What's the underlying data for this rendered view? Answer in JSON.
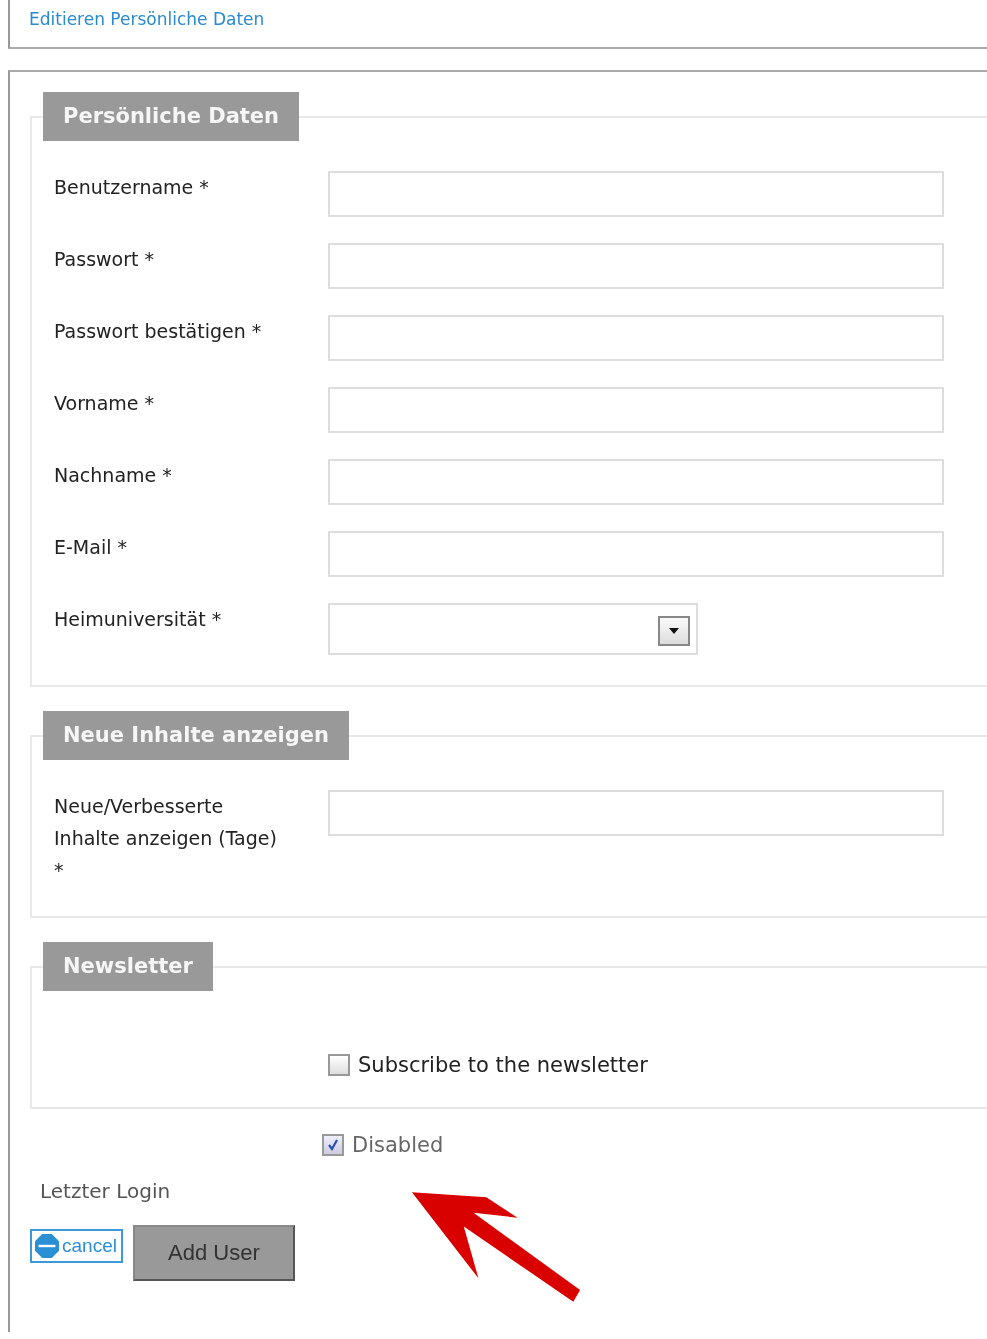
{
  "header": {
    "title": "Editieren Persönliche Daten"
  },
  "sections": [
    {
      "legend": "Persönliche Daten",
      "fields": [
        {
          "kind": "text",
          "label": "Benutzername *"
        },
        {
          "kind": "text",
          "label": "Passwort *"
        },
        {
          "kind": "text",
          "label": "Passwort bestätigen *"
        },
        {
          "kind": "text",
          "label": "Vorname *"
        },
        {
          "kind": "text",
          "label": "Nachname *"
        },
        {
          "kind": "text",
          "label": "E-Mail *"
        },
        {
          "kind": "select",
          "label": "Heimuniversität *"
        }
      ]
    },
    {
      "legend": "Neue Inhalte anzeigen",
      "fields": [
        {
          "kind": "text",
          "label": "Neue/Verbesserte Inhalte anzeigen (Tage) *"
        }
      ]
    },
    {
      "legend": "Newsletter",
      "fields": [
        {
          "kind": "checkbox",
          "label": "Subscribe to the newsletter",
          "checked": false
        }
      ]
    }
  ],
  "disabled": {
    "label": "Disabled",
    "checked": true
  },
  "last_login": {
    "label": "Letzter Login"
  },
  "buttons": [
    {
      "kind": "cancel",
      "label": "cancel"
    },
    {
      "kind": "submit",
      "label": "Add User"
    }
  ]
}
